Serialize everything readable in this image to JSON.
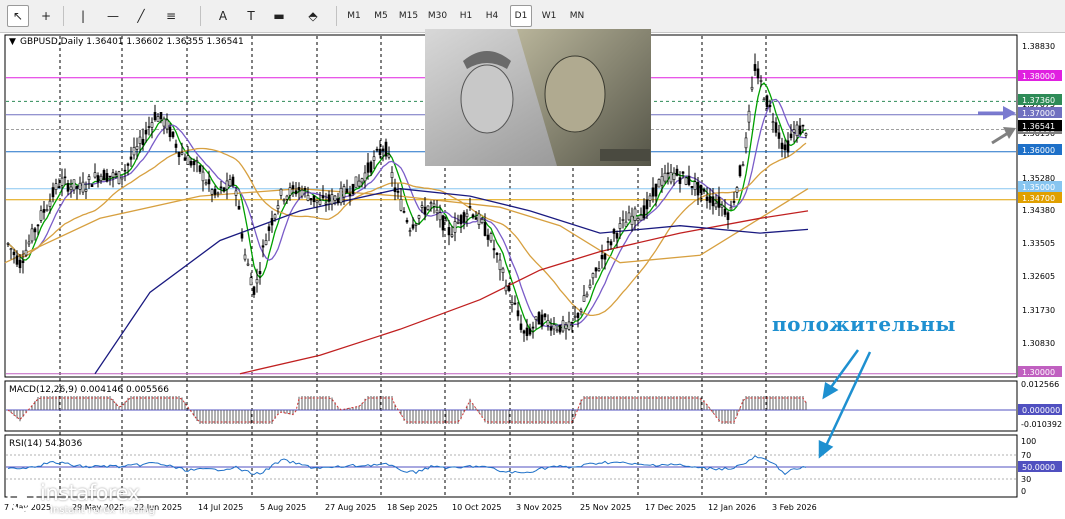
{
  "toolbar": {
    "tools": [
      {
        "name": "cursor-tool",
        "glyph": "↖"
      },
      {
        "name": "crosshair-tool",
        "glyph": "+"
      },
      {
        "name": "vertical-line-tool",
        "glyph": "|"
      },
      {
        "name": "horizontal-line-tool",
        "glyph": "—"
      },
      {
        "name": "trendline-tool",
        "glyph": "╱"
      },
      {
        "name": "fibonacci-tool",
        "glyph": "≡"
      },
      {
        "name": "text-tool",
        "glyph": "A"
      },
      {
        "name": "label-tool",
        "glyph": "T"
      },
      {
        "name": "rectangle-tool",
        "glyph": "▬"
      },
      {
        "name": "arrows-tool",
        "glyph": "⬘"
      }
    ],
    "timeframes": [
      "M1",
      "M5",
      "M15",
      "M30",
      "H1",
      "H4",
      "D1",
      "W1",
      "MN"
    ],
    "active_timeframe": "D1"
  },
  "chart": {
    "symbol_info": "GBPUSD,Daily  1.36401 1.36602 1.36355 1.36541",
    "price_axis": [
      "1.38830",
      "1.37945",
      "1.37075",
      "1.36190",
      "1.35280",
      "1.34380",
      "1.33505",
      "1.32605",
      "1.31730",
      "1.30830"
    ],
    "level_labels": [
      {
        "text": "1.38000",
        "color": "#e020e0"
      },
      {
        "text": "1.37360",
        "color": "#2e8b57"
      },
      {
        "text": "1.37000",
        "color": "#7070c0"
      },
      {
        "text": "1.36600",
        "color": "#808080"
      },
      {
        "text": "1.36541",
        "color": "#000000"
      },
      {
        "text": "1.36000",
        "color": "#1e70c8"
      },
      {
        "text": "1.35000",
        "color": "#87c5f0"
      },
      {
        "text": "1.34700",
        "color": "#e0a000"
      },
      {
        "text": "1.30000",
        "color": "#c060c0"
      }
    ],
    "date_axis": [
      "7 May 2025",
      "29 May 2025",
      "22 Jun 2025",
      "14 Jul 2025",
      "5 Aug 2025",
      "27 Aug 2025",
      "18 Sep 2025",
      "10 Oct 2025",
      "3 Nov 2025",
      "25 Nov 2025",
      "17 Dec 2025",
      "12 Jan 2026",
      "3 Feb 2026"
    ],
    "annotation": "положительны"
  },
  "macd": {
    "label": "MACD(12,26,9) 0.004146 0.005566",
    "axis": [
      "0.012566",
      "0.000000",
      "-0.010392"
    ]
  },
  "rsi": {
    "label": "RSI(14) 54.8036",
    "axis": [
      "100",
      "70",
      "50.0000",
      "30",
      "0"
    ]
  },
  "watermark": {
    "brand": "instaforex",
    "tagline": "Instant Forex Trading"
  },
  "colors": {
    "candle": "#000000",
    "ma_green": "#00a000",
    "ma_purple": "#7a5cc8",
    "ma_orange": "#d7a040",
    "ma_red": "#c02020",
    "ma_navy": "#1a1a80",
    "arrow_blue": "#1e90d0",
    "macd_signal": "#d03030",
    "rsi_line": "#1e70c8"
  }
}
